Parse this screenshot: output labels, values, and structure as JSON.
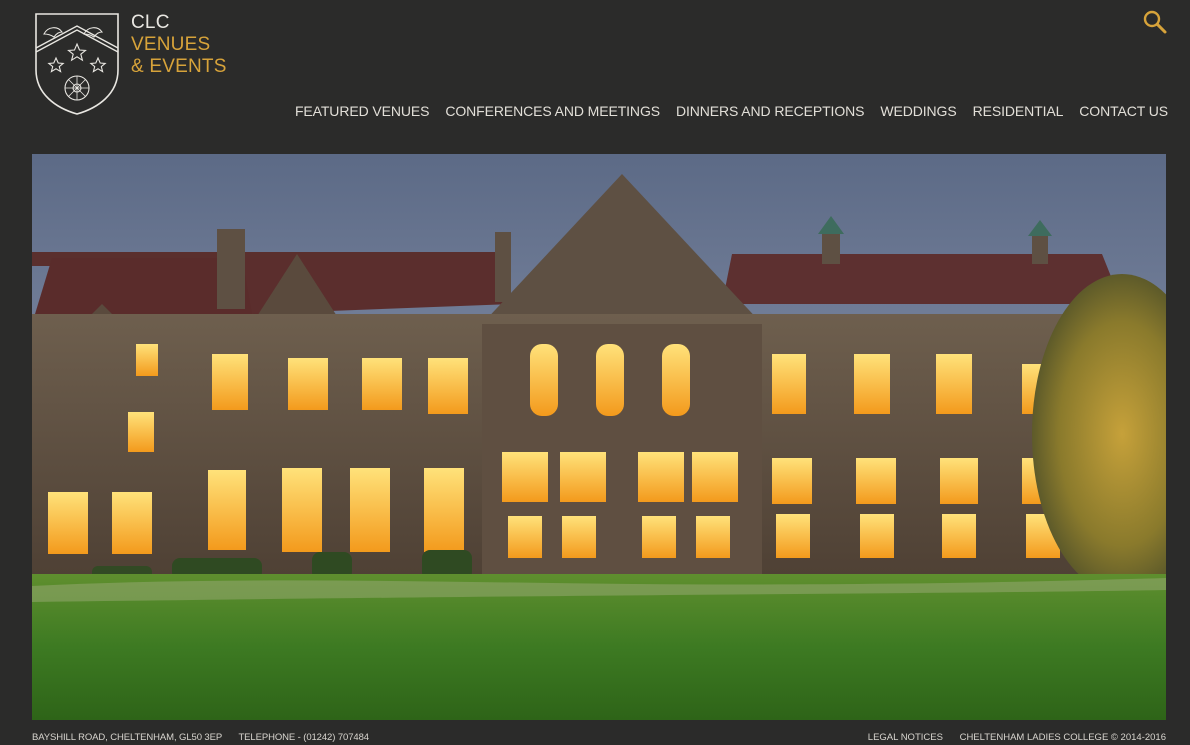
{
  "brand": {
    "line1": "CLC",
    "line2": "VENUES",
    "line3": "& EVENTS",
    "accent_color": "#d7a33a",
    "text_color": "#e9e7e2",
    "crest_icon": "college-crest-icon"
  },
  "search": {
    "icon": "search-icon"
  },
  "nav": {
    "items": [
      {
        "label": "FEATURED VENUES"
      },
      {
        "label": "CONFERENCES AND MEETINGS"
      },
      {
        "label": "DINNERS AND RECEPTIONS"
      },
      {
        "label": "WEDDINGS"
      },
      {
        "label": "RESIDENTIAL"
      },
      {
        "label": "CONTACT US"
      }
    ]
  },
  "hero": {
    "image_description": "Gothic stone college building at dusk with lit windows and lawn"
  },
  "footer": {
    "address": "BAYSHILL ROAD, CHELTENHAM, GL50 3EP",
    "telephone": "TELEPHONE - (01242) 707484",
    "legal_label": "LEGAL NOTICES",
    "copyright": "CHELTENHAM LADIES COLLEGE © 2014-2016"
  },
  "colors": {
    "background": "#2b2b2a",
    "nav_text": "#e2dfd8"
  }
}
